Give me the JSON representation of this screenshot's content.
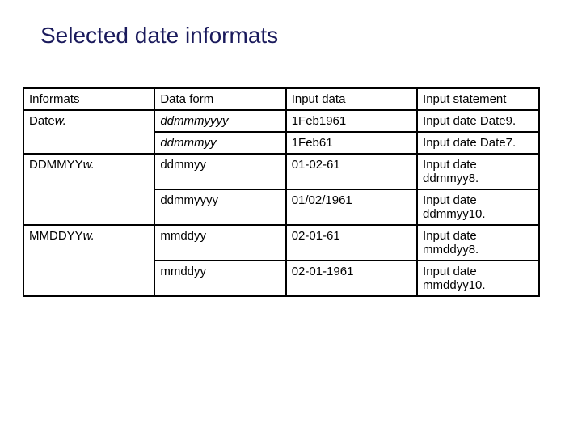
{
  "title": "Selected date informats",
  "table": {
    "r0": {
      "c0": "Informats",
      "c1": "Data form",
      "c2": "Input data",
      "c3": "Input statement"
    },
    "r1": {
      "c0a": "Date",
      "c0b": "w.",
      "c1": "ddmmmyyyy",
      "c2": "1Feb1961",
      "c3": "Input date Date9."
    },
    "r2": {
      "c1": "ddmmmyy",
      "c2": "1Feb61",
      "c3": "Input date Date7."
    },
    "r3": {
      "c0a": "DDMMYY",
      "c0b": "w.",
      "c1": "ddmmyy",
      "c2": "01-02-61",
      "c3": "Input date ddmmyy8."
    },
    "r4": {
      "c1": "ddmmyyyy",
      "c2": "01/02/1961",
      "c3": "Input date ddmmyy10."
    },
    "r5": {
      "c0a": "MMDDYY",
      "c0b": "w.",
      "c1": "mmddyy",
      "c2": "02-01-61",
      "c3": "Input date mmddyy8."
    },
    "r6": {
      "c1": "mmddyy",
      "c2": "02-01-1961",
      "c3": "Input date mmddyy10."
    }
  }
}
